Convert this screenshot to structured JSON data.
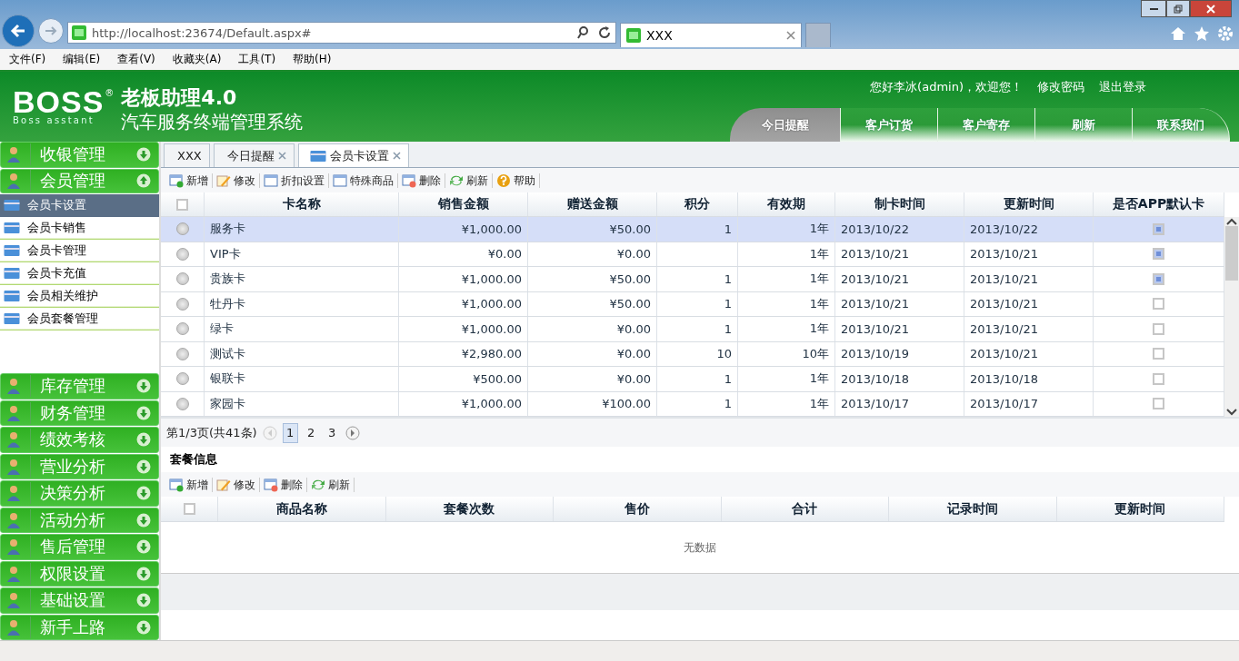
{
  "browser": {
    "address": "http://localhost:23674/Default.aspx#",
    "tabs": [
      {
        "label": "XXX",
        "selected": true
      }
    ],
    "menu": [
      "文件(F)",
      "编辑(E)",
      "查看(V)",
      "收藏夹(A)",
      "工具(T)",
      "帮助(H)"
    ]
  },
  "header": {
    "logo": "BOSS",
    "logo_mark": "®",
    "logo_sub": "Boss asstant",
    "product": "老板助理4.0",
    "subtitle": "汽车服务终端管理系统",
    "greeting": "您好李冰(admin)，欢迎您！",
    "links": [
      "修改密码",
      "退出登录"
    ],
    "nav": [
      {
        "label": "今日提醒",
        "selected": true
      },
      {
        "label": "客户订货",
        "selected": false
      },
      {
        "label": "客户寄存",
        "selected": false
      },
      {
        "label": "刷新",
        "selected": false
      },
      {
        "label": "联系我们",
        "selected": false
      }
    ]
  },
  "sidebar": {
    "groups": [
      {
        "label": "收银管理",
        "expanded": false
      },
      {
        "label": "会员管理",
        "expanded": true,
        "items": [
          {
            "label": "会员卡设置",
            "selected": true
          },
          {
            "label": "会员卡销售",
            "selected": false
          },
          {
            "label": "会员卡管理",
            "selected": false
          },
          {
            "label": "会员卡充值",
            "selected": false
          },
          {
            "label": "会员相关维护",
            "selected": false
          },
          {
            "label": "会员套餐管理",
            "selected": false
          }
        ]
      },
      {
        "label": "库存管理",
        "expanded": false
      },
      {
        "label": "财务管理",
        "expanded": false
      },
      {
        "label": "绩效考核",
        "expanded": false
      },
      {
        "label": "营业分析",
        "expanded": false
      },
      {
        "label": "决策分析",
        "expanded": false
      },
      {
        "label": "活动分析",
        "expanded": false
      },
      {
        "label": "售后管理",
        "expanded": false
      },
      {
        "label": "权限设置",
        "expanded": false
      },
      {
        "label": "基础设置",
        "expanded": false
      },
      {
        "label": "新手上路",
        "expanded": false
      }
    ]
  },
  "content_tabs": [
    {
      "label": "XXX",
      "closable": false,
      "selected": false
    },
    {
      "label": "今日提醒",
      "closable": true,
      "selected": false
    },
    {
      "label": "会员卡设置",
      "closable": true,
      "selected": true
    }
  ],
  "toolbar": [
    {
      "kind": "add",
      "label": "新增"
    },
    {
      "kind": "edit",
      "label": "修改"
    },
    {
      "kind": "window",
      "label": "折扣设置"
    },
    {
      "kind": "window",
      "label": "特殊商品"
    },
    {
      "kind": "delete",
      "label": "删除"
    },
    {
      "kind": "refresh",
      "label": "刷新"
    },
    {
      "kind": "help",
      "label": "帮助"
    }
  ],
  "table": {
    "select_all_checked": false,
    "columns": [
      "卡名称",
      "销售金额",
      "赠送金额",
      "积分",
      "有效期",
      "制卡时间",
      "更新时间",
      "是否APP默认卡"
    ],
    "rows": [
      {
        "selected": true,
        "default_card": true,
        "cells": [
          "服务卡",
          "¥1,000.00",
          "¥50.00",
          "1",
          "1年",
          "2013/10/22",
          "2013/10/22"
        ]
      },
      {
        "selected": false,
        "default_card": true,
        "cells": [
          "VIP卡",
          "¥0.00",
          "¥0.00",
          "",
          "1年",
          "2013/10/21",
          "2013/10/21"
        ]
      },
      {
        "selected": false,
        "default_card": true,
        "cells": [
          "贵族卡",
          "¥1,000.00",
          "¥50.00",
          "1",
          "1年",
          "2013/10/21",
          "2013/10/21"
        ]
      },
      {
        "selected": false,
        "default_card": false,
        "cells": [
          "牡丹卡",
          "¥1,000.00",
          "¥50.00",
          "1",
          "1年",
          "2013/10/21",
          "2013/10/21"
        ]
      },
      {
        "selected": false,
        "default_card": false,
        "cells": [
          "绿卡",
          "¥1,000.00",
          "¥0.00",
          "1",
          "1年",
          "2013/10/21",
          "2013/10/21"
        ]
      },
      {
        "selected": false,
        "default_card": false,
        "cells": [
          "测试卡",
          "¥2,980.00",
          "¥0.00",
          "10",
          "10年",
          "2013/10/19",
          "2013/10/21"
        ]
      },
      {
        "selected": false,
        "default_card": false,
        "cells": [
          "银联卡",
          "¥500.00",
          "¥0.00",
          "1",
          "1年",
          "2013/10/18",
          "2013/10/18"
        ]
      },
      {
        "selected": false,
        "default_card": false,
        "cells": [
          "家园卡",
          "¥1,000.00",
          "¥100.00",
          "1",
          "1年",
          "2013/10/17",
          "2013/10/17"
        ]
      }
    ]
  },
  "pagination": {
    "summary": "第1/3页(共41条)",
    "pages": [
      {
        "label": "1",
        "selected": true
      },
      {
        "label": "2",
        "selected": false
      },
      {
        "label": "3",
        "selected": false
      }
    ]
  },
  "package": {
    "title": "套餐信息",
    "toolbar": [
      {
        "kind": "add",
        "label": "新增"
      },
      {
        "kind": "edit",
        "label": "修改"
      },
      {
        "kind": "delete",
        "label": "删除"
      },
      {
        "kind": "refresh",
        "label": "刷新"
      }
    ],
    "select_all_checked": false,
    "columns": [
      "商品名称",
      "套餐次数",
      "售价",
      "合计",
      "记录时间",
      "更新时间"
    ],
    "empty": "无数据"
  }
}
